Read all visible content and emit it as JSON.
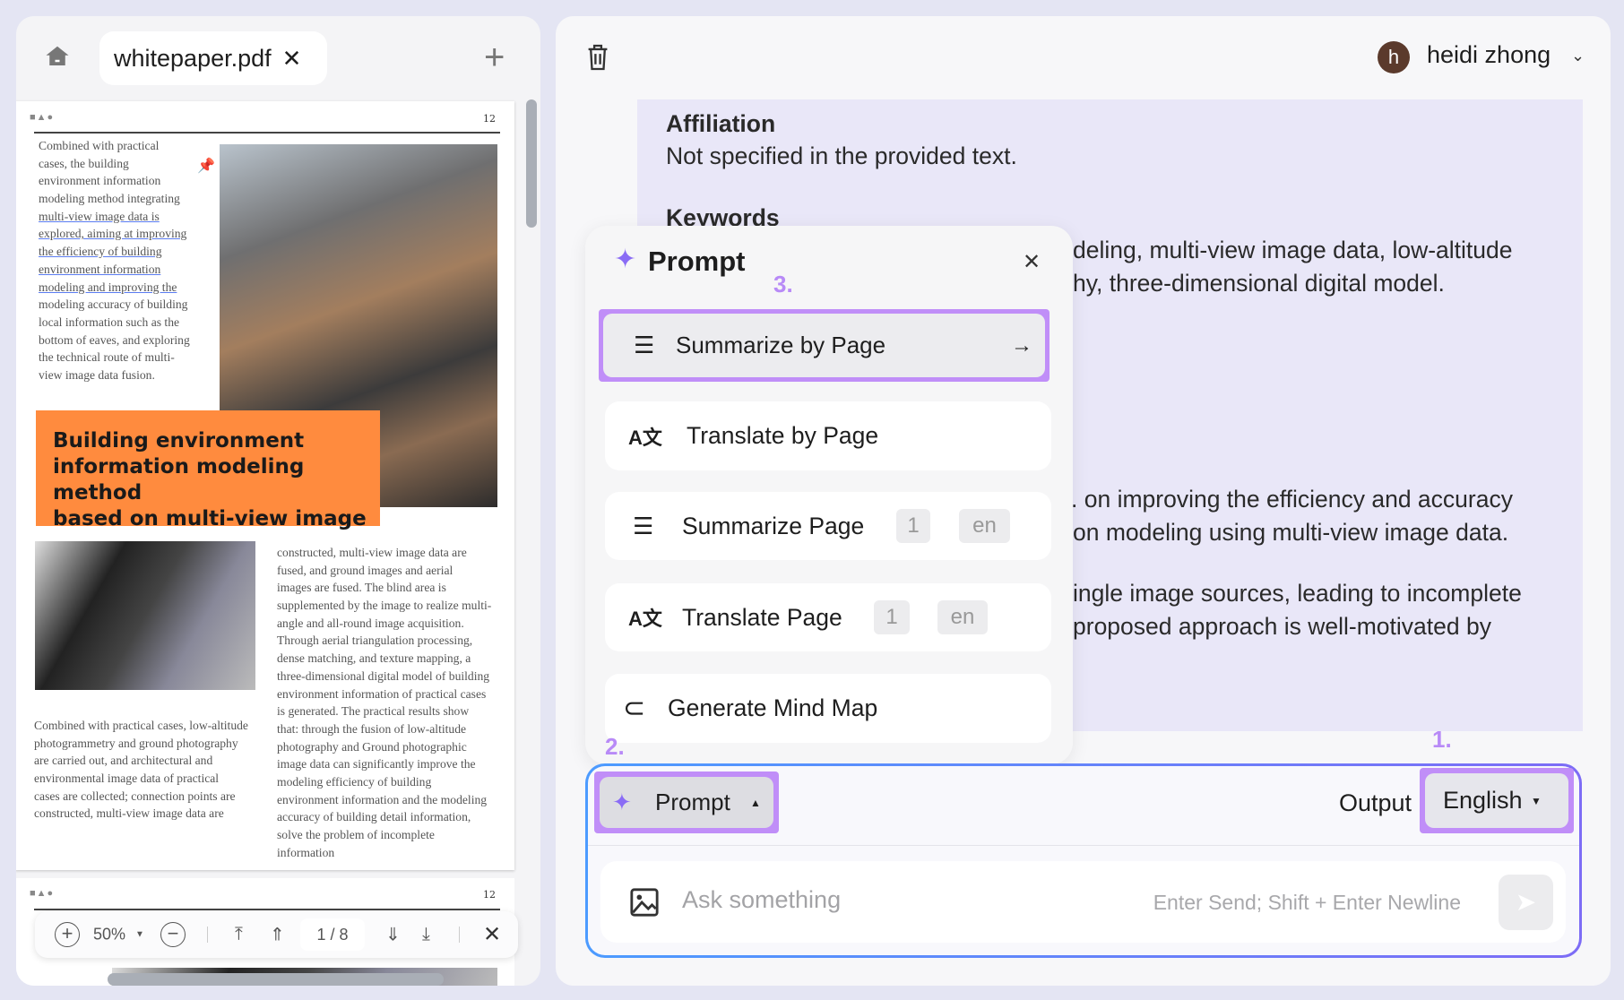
{
  "left_panel": {
    "tab_label": "whitepaper.pdf",
    "page_number": "12",
    "header_icons": "■▲●",
    "left_column_lines": [
      "Combined with practical",
      "cases, the building",
      "environment information",
      "modeling method integrating",
      "multi-view image data is",
      "explored, aiming at improving",
      "the efficiency of building",
      "environment information",
      "modeling and improving the",
      "modeling accuracy of building",
      "local information such as the",
      "bottom of eaves, and exploring",
      "the technical route of multi-",
      "view image data fusion."
    ],
    "title_lines": [
      "Building environment",
      "information modeling method",
      "based on multi-view image"
    ],
    "right_column_lines": [
      "constructed, multi-view image data are",
      "fused, and ground images and aerial",
      "images are fused. The blind area is",
      "supplemented by the image to realize multi-",
      "angle and all-round image acquisition.",
      "Through aerial triangulation processing,",
      "dense matching, and texture mapping, a",
      "three-dimensional digital model of building",
      "environment information of practical cases",
      "is generated. The practical results show",
      "that: through the fusion of low-altitude",
      "photography and Ground photographic",
      "image data can significantly improve the",
      "modeling efficiency of building",
      "environment information and the modeling",
      "accuracy of building detail information,",
      "solve the problem of incomplete",
      "information"
    ],
    "bottom_left_lines": [
      "Combined with practical cases, low-altitude",
      "photogrammetry and ground photography",
      "are carried out, and architectural and",
      "environmental image data of practical",
      "cases are collected; connection points are",
      "constructed, multi-view image data are"
    ],
    "page2_number": "12",
    "toolbar": {
      "zoom": "50%",
      "page": "1 / 8"
    }
  },
  "right_panel": {
    "user_initial": "h",
    "user_name": "heidi zhong",
    "affiliation_heading": "Affiliation",
    "affiliation_text": "Not specified in the provided text.",
    "keywords_heading": "Keywords",
    "fragments": [
      "deling, multi-view image data, low-altitude",
      "hy, three-dimensional digital model.",
      ". on improving the efficiency and accuracy",
      "on modeling using multi-view image data.",
      "ingle image sources, leading to incomplete",
      "proposed approach is well-motivated by"
    ]
  },
  "popup": {
    "title": "Prompt",
    "items": [
      {
        "label": "Summarize by Page"
      },
      {
        "label": "Translate by Page"
      },
      {
        "label": "Summarize Page",
        "page": "1",
        "lang": "en"
      },
      {
        "label": "Translate Page",
        "page": "1",
        "lang": "en"
      },
      {
        "label": "Generate Mind Map"
      }
    ]
  },
  "annotations": {
    "step1": "1.",
    "step2": "2.",
    "step3": "3."
  },
  "composer": {
    "prompt_label": "Prompt",
    "output_label": "Output",
    "language": "English",
    "placeholder": "Ask something",
    "hint": "Enter Send; Shift + Enter Newline"
  },
  "colors": {
    "accent": "#c08ef8",
    "orange": "#ff8b3e",
    "border_start": "#4c9bff",
    "border_end": "#7d6cf6"
  }
}
